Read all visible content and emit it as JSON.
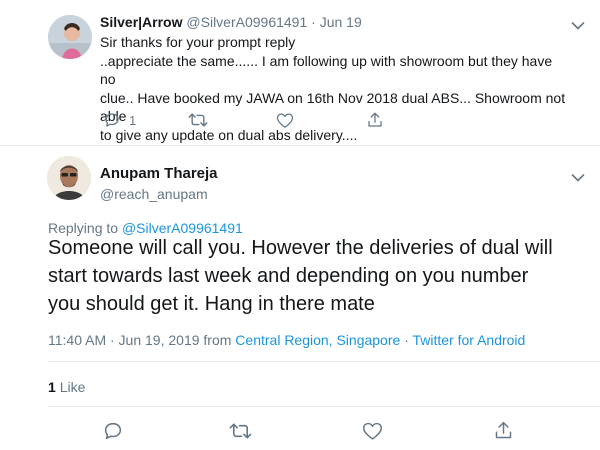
{
  "parent_tweet": {
    "display_name": "Silver|Arrow",
    "handle": "@SilverA09961491",
    "separator": "·",
    "date": "Jun 19",
    "text_lines": [
      "Sir thanks for your prompt reply",
      "..appreciate the same...... I am following up with showroom but they have no",
      "clue.. Have booked my JAWA on 16th Nov 2018 dual ABS... Showroom not able",
      "to give any update on dual abs delivery...."
    ],
    "reply_count": "1",
    "icons": [
      "reply-icon",
      "retweet-icon",
      "like-icon",
      "share-icon",
      "chevron-down-icon"
    ]
  },
  "main_tweet": {
    "display_name": "Anupam Thareja",
    "handle": "@reach_anupam",
    "replying_prefix": "Replying to",
    "replying_to": "@SilverA09961491",
    "text_lines": [
      "Someone will call you. However the deliveries of dual will",
      "start towards last week and depending on you number",
      "you should get it. Hang in there mate"
    ],
    "timestamp": "11:40 AM · Jun 19, 2019",
    "from_word": "from",
    "location": "Central Region, Singapore",
    "dot": "·",
    "source": "Twitter for Android",
    "like_count": "1",
    "like_label": "Like",
    "icons": [
      "reply-icon",
      "retweet-icon",
      "like-icon",
      "share-icon",
      "chevron-down-icon"
    ]
  },
  "colors": {
    "text": "#14171a",
    "muted": "#657786",
    "link": "#1b95e0",
    "divider": "#e6ecf0"
  }
}
